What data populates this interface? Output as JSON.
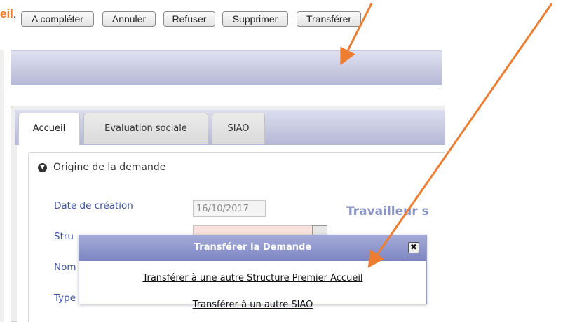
{
  "document_fragment": {
    "text": "eil",
    "trailing": "."
  },
  "toolbar": {
    "buttons": [
      "A compléter",
      "Annuler",
      "Refuser",
      "Supprimer",
      "Transférer"
    ]
  },
  "tabs": [
    {
      "label": "Accueil",
      "active": true
    },
    {
      "label": "Evaluation sociale",
      "active": false
    },
    {
      "label": "SIAO",
      "active": false
    }
  ],
  "section": {
    "title": "Origine de la demande",
    "toggle_icon": "circle-arrow-down-icon"
  },
  "fields": {
    "date_label": "Date de création",
    "date_value": "16/10/2017",
    "structure_label_partial": "Stru",
    "nom_label_partial": "Nom",
    "type_label_partial": "Type"
  },
  "side_heading_partial": "Travailleur s",
  "modal": {
    "title": "Transférer la Demande",
    "close_icon": "close-icon",
    "links": [
      "Transférer à une autre Structure Premier Accueil",
      "Transférer à un autre SIAO"
    ]
  },
  "colors": {
    "annotation_arrow": "#ed7d31",
    "modal_header": "#8c94cc",
    "toolbar": "#c4c6e0",
    "label_blue": "#3c4fa0",
    "required_field": "#f9e2db"
  }
}
